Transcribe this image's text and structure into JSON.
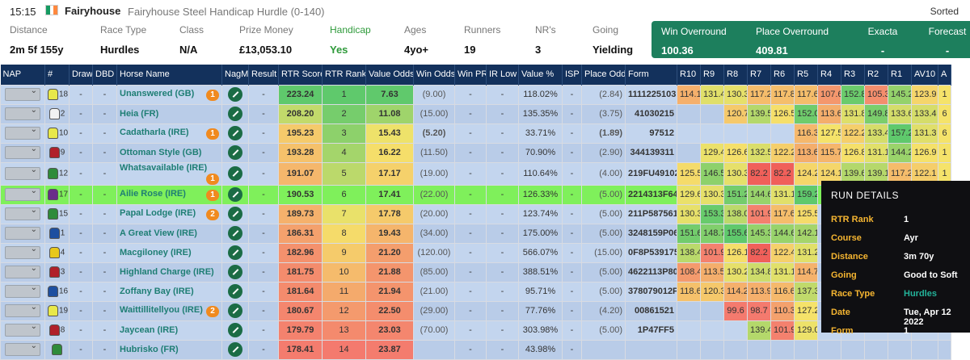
{
  "header": {
    "time": "15:15",
    "course": "Fairyhouse",
    "race_name": "Fairyhouse Steel Handicap Hurdle (0-140)",
    "sorted": "Sorted",
    "flag_colors": [
      "#169b62",
      "#ffffff",
      "#ff883e"
    ]
  },
  "info": [
    {
      "label": "Distance",
      "value": "2m 5f 155y"
    },
    {
      "label": "Race Type",
      "value": "Hurdles"
    },
    {
      "label": "Class",
      "value": "N/A"
    },
    {
      "label": "Prize Money",
      "value": "£13,053.10"
    },
    {
      "label": "Handicap",
      "value": "Yes"
    },
    {
      "label": "Ages",
      "value": "4yo+"
    },
    {
      "label": "Runners",
      "value": "19"
    },
    {
      "label": "NR's",
      "value": "3"
    },
    {
      "label": "Going",
      "value": "Yielding"
    }
  ],
  "overround": [
    {
      "label": "Win Overround",
      "value": "100.36"
    },
    {
      "label": "Place Overround",
      "value": "409.81"
    },
    {
      "label": "Exacta",
      "value": "-"
    },
    {
      "label": "Forecast",
      "value": "-"
    }
  ],
  "columns": [
    "NAP",
    "#",
    "Draw",
    "DBD",
    "Horse Name",
    "NagMe",
    "Result",
    "RTR Score",
    "RTR Rank",
    "Value Odds",
    "Win Odds",
    "Win PR",
    "IR Low",
    "Value %",
    "ISP",
    "Place Odds",
    "Form",
    "R10",
    "R9",
    "R8",
    "R7",
    "R6",
    "R5",
    "R4",
    "R3",
    "R2",
    "R1",
    "AV10",
    "A"
  ],
  "rows": [
    {
      "num": "18",
      "silk": "#e8e84a",
      "name": "Unanswered (GB)",
      "badge": "1",
      "score": "223.24",
      "rank": "1",
      "vodds": "7.63",
      "wodds": "(9.00)",
      "vpct": "118.02%",
      "podds": "(2.84)",
      "form": "1111225103",
      "r": [
        "114.1",
        "131.4",
        "130.3",
        "117.2",
        "117.8",
        "117.6",
        "107.6",
        "152.8",
        "105.3",
        "145.2"
      ],
      "av": "123.9",
      "a": "1"
    },
    {
      "num": "2",
      "silk": "#f2f2f2",
      "name": "Heia (FR)",
      "badge": "",
      "score": "208.20",
      "rank": "2",
      "vodds": "11.08",
      "wodds": "(15.00)",
      "vpct": "135.35%",
      "podds": "(3.75)",
      "form": "41030215",
      "r": [
        "",
        "",
        "120.7",
        "139.5",
        "126.5",
        "152.0",
        "113.6",
        "131.8",
        "149.8",
        "133.6"
      ],
      "av": "133.4",
      "a": "6"
    },
    {
      "num": "10",
      "silk": "#e8e84a",
      "name": "Cadatharla (IRE)",
      "badge": "1",
      "score": "195.23",
      "rank": "3",
      "vodds": "15.43",
      "wodds": "(5.20)",
      "vpct": "33.71%",
      "podds": "(1.89)",
      "form": "97512",
      "r": [
        "",
        "",
        "",
        "",
        "",
        "116.3",
        "127.5",
        "122.2",
        "133.4",
        "157.2"
      ],
      "av": "131.3",
      "a": "6"
    },
    {
      "num": "9",
      "silk": "#b0202a",
      "name": "Ottoman Style (GB)",
      "badge": "",
      "score": "193.28",
      "rank": "4",
      "vodds": "16.22",
      "wodds": "(11.50)",
      "vpct": "70.90%",
      "podds": "(2.90)",
      "form": "344139311",
      "r": [
        "",
        "129.4",
        "126.6",
        "132.5",
        "122.2",
        "113.6",
        "115.7",
        "126.8",
        "131.1",
        "144.2"
      ],
      "av": "126.9",
      "a": "1"
    },
    {
      "num": "12",
      "silk": "#2e8b3a",
      "name": "Whatsavailable (IRE)",
      "badge": "1",
      "score": "191.07",
      "rank": "5",
      "vodds": "17.17",
      "wodds": "(19.00)",
      "vpct": "110.64%",
      "podds": "(4.00)",
      "form": "219FU49102",
      "r": [
        "125.5",
        "146.5",
        "130.3",
        "82.2",
        "82.2",
        "124.2",
        "124.1",
        "139.6",
        "139.1",
        "117.2"
      ],
      "av": "122.1",
      "a": "1"
    },
    {
      "num": "17",
      "silk": "#6a2c8a",
      "name": "Ailie Rose (IRE)",
      "badge": "1",
      "score": "190.53",
      "rank": "6",
      "vodds": "17.41",
      "wodds": "(22.00)",
      "vpct": "126.33%",
      "podds": "(5.00)",
      "form": "2214313F64",
      "r": [
        "129.6",
        "130.3",
        "151.2",
        "144.6",
        "131.1",
        "159.2",
        "",
        "",
        "",
        ""
      ],
      "av": "",
      "a": "",
      "highlight": true
    },
    {
      "num": "15",
      "silk": "#2e8b3a",
      "name": "Papal Lodge (IRE)",
      "badge": "2",
      "score": "189.73",
      "rank": "7",
      "vodds": "17.78",
      "wodds": "(20.00)",
      "vpct": "123.74%",
      "podds": "(5.00)",
      "form": "211P587561",
      "r": [
        "130.3",
        "153.3",
        "138.0",
        "101.9",
        "117.6",
        "125.5",
        "",
        "",
        "",
        ""
      ],
      "av": "",
      "a": ""
    },
    {
      "num": "1",
      "silk": "#1d4fa0",
      "name": "A Great View (IRE)",
      "badge": "",
      "score": "186.31",
      "rank": "8",
      "vodds": "19.43",
      "wodds": "(34.00)",
      "vpct": "175.00%",
      "podds": "(5.00)",
      "form": "3248159P06",
      "r": [
        "151.6",
        "148.7",
        "155.6",
        "145.3",
        "144.6",
        "142.1",
        "",
        "",
        "",
        ""
      ],
      "av": "",
      "a": ""
    },
    {
      "num": "4",
      "silk": "#e8c81a",
      "name": "Macgiloney (IRE)",
      "badge": "",
      "score": "182.96",
      "rank": "9",
      "vodds": "21.20",
      "wodds": "(120.00)",
      "vpct": "566.07%",
      "podds": "(15.00)",
      "form": "0F8P539175",
      "r": [
        "138.4",
        "101.9",
        "126.1",
        "82.2",
        "122.4",
        "131.2",
        "",
        "",
        "",
        ""
      ],
      "av": "",
      "a": ""
    },
    {
      "num": "3",
      "silk": "#b0202a",
      "name": "Highland Charge (IRE)",
      "badge": "",
      "score": "181.75",
      "rank": "10",
      "vodds": "21.88",
      "wodds": "(85.00)",
      "vpct": "388.51%",
      "podds": "(5.00)",
      "form": "4622113P80",
      "r": [
        "108.4",
        "113.5",
        "130.2",
        "134.8",
        "131.1",
        "114.7",
        "",
        "",
        "",
        ""
      ],
      "av": "",
      "a": ""
    },
    {
      "num": "16",
      "silk": "#1d4fa0",
      "name": "Zoffany Bay (IRE)",
      "badge": "",
      "score": "181.64",
      "rank": "11",
      "vodds": "21.94",
      "wodds": "(21.00)",
      "vpct": "95.71%",
      "podds": "(5.00)",
      "form": "378079012P",
      "r": [
        "118.6",
        "120.3",
        "114.2",
        "113.9",
        "116.6",
        "137.3",
        "",
        "",
        "",
        ""
      ],
      "av": "",
      "a": ""
    },
    {
      "num": "19",
      "silk": "#e8e84a",
      "name": "Waittillitellyou (IRE)",
      "badge": "2",
      "score": "180.67",
      "rank": "12",
      "vodds": "22.50",
      "wodds": "(29.00)",
      "vpct": "77.76%",
      "podds": "(4.20)",
      "form": "00861521",
      "r": [
        "",
        "",
        "99.6",
        "98.7",
        "110.3",
        "127.2",
        "",
        "",
        "",
        ""
      ],
      "av": "",
      "a": ""
    },
    {
      "num": "8",
      "silk": "#b0202a",
      "name": "Jaycean (IRE)",
      "badge": "",
      "score": "179.79",
      "rank": "13",
      "vodds": "23.03",
      "wodds": "(70.00)",
      "vpct": "303.98%",
      "podds": "(5.00)",
      "form": "1P47FF5",
      "r": [
        "",
        "",
        "",
        "139.4",
        "101.9",
        "129.0",
        "",
        "",
        "",
        ""
      ],
      "av": "",
      "a": ""
    },
    {
      "num": "",
      "silk": "#2e8b3a",
      "name": "Hubrisko (FR)",
      "badge": "",
      "score": "178.41",
      "rank": "14",
      "vodds": "23.87",
      "wodds": "",
      "vpct": "43.98%",
      "podds": "",
      "form": "",
      "r": [
        "",
        "",
        "",
        "",
        "",
        "",
        "",
        "",
        "",
        ""
      ],
      "av": "",
      "a": ""
    }
  ],
  "tooltip": {
    "title": "RUN DETAILS",
    "rows": [
      {
        "label": "RTR Rank",
        "value": "1"
      },
      {
        "label": "Course",
        "value": "Ayr"
      },
      {
        "label": "Distance",
        "value": "3m 70y"
      },
      {
        "label": "Going",
        "value": "Good to Soft"
      },
      {
        "label": "Race Type",
        "value": "Hurdles"
      },
      {
        "label": "Date",
        "value": "Tue, Apr 12 2022"
      },
      {
        "label": "Form",
        "value": "1"
      }
    ]
  }
}
